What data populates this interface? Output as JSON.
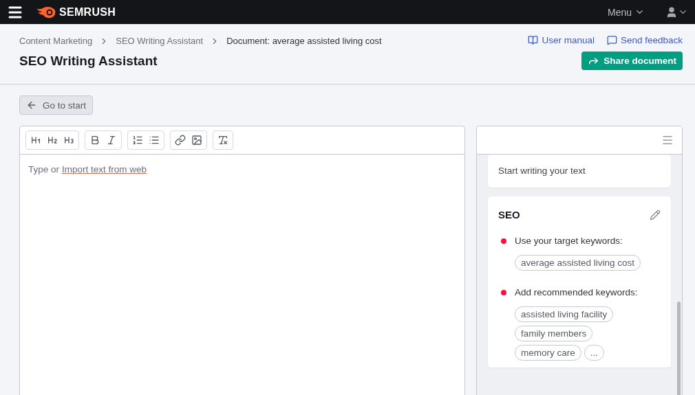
{
  "topbar": {
    "brand": "SEMRUSH",
    "menu": "Menu"
  },
  "breadcrumbs": [
    {
      "label": "Content Marketing"
    },
    {
      "label": "SEO Writing Assistant"
    },
    {
      "label": "Document: average assisted living cost"
    }
  ],
  "title": "SEO Writing Assistant",
  "links": [
    {
      "label": "User manual",
      "kind": "manual"
    },
    {
      "label": "Send feedback",
      "kind": "feedback"
    }
  ],
  "share_button": "Share document",
  "back_button": "Go to start",
  "editor": {
    "placeholder_prefix": "Type or",
    "import_link": "Import text from web"
  },
  "panel": {
    "status": "Start writing your text",
    "seo": {
      "title": "SEO",
      "checks": [
        {
          "label": "Use your target keywords:",
          "color": "#ff0f3e",
          "keywords": [
            "average assisted living cost"
          ]
        },
        {
          "label": "Add recommended keywords:",
          "color": "#ff0f3e",
          "keywords": [
            "assisted living facility",
            "family members",
            "memory care",
            "..."
          ]
        }
      ]
    }
  }
}
